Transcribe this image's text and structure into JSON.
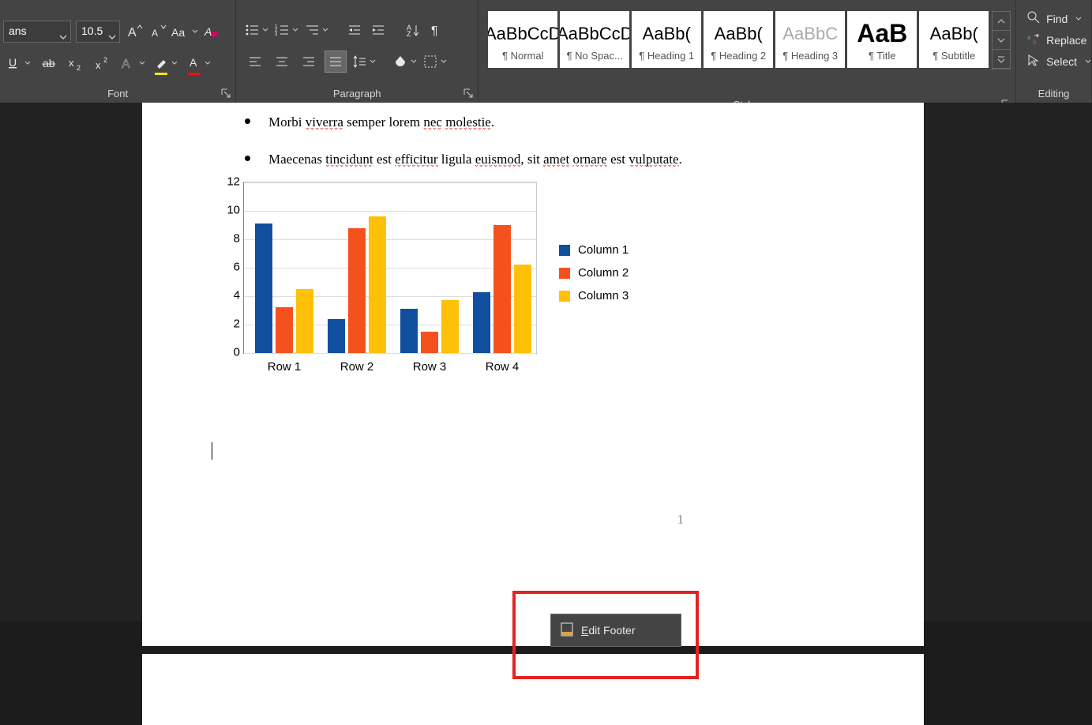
{
  "ribbon": {
    "font": {
      "group_label": "Font",
      "font_name": "ans",
      "font_size": "10.5"
    },
    "paragraph": {
      "group_label": "Paragraph"
    },
    "styles": {
      "group_label": "Styles",
      "tiles": [
        {
          "sample": "AaBbCcD",
          "name": "¶ Normal"
        },
        {
          "sample": "AaBbCcD",
          "name": "¶ No Spac..."
        },
        {
          "sample": "AaBb(",
          "name": "¶ Heading 1"
        },
        {
          "sample": "AaBb(",
          "name": "¶ Heading 2"
        },
        {
          "sample": "AaBbC",
          "name": "¶ Heading 3"
        },
        {
          "sample": "AaB",
          "name": "¶ Title"
        },
        {
          "sample": "AaBb(",
          "name": "¶ Subtitle"
        }
      ]
    },
    "editing": {
      "group_label": "Editing",
      "find": "Find",
      "replace": "Replace",
      "select": "Select"
    }
  },
  "document": {
    "bullets": [
      {
        "pre": "Morbi ",
        "sq1": "viverra",
        "mid": " semper lorem ",
        "sq2": "nec",
        "mid2": " ",
        "sq3": "molestie",
        "post": "."
      },
      {
        "pre": "Maecenas ",
        "sq1": "tincidunt",
        "mid": " est ",
        "sq2": "efficitur",
        "mid2": " ligula ",
        "sq3": "euismod",
        "post2": ", sit ",
        "sq4": "amet",
        "post3": " ",
        "sq5": "ornare",
        "post4": " est ",
        "sq6": "vulputate",
        "post5": "."
      }
    ],
    "page_number": "1"
  },
  "context_menu": {
    "edit_footer": "Edit Footer"
  },
  "chart_data": {
    "type": "bar",
    "categories": [
      "Row 1",
      "Row 2",
      "Row 3",
      "Row 4"
    ],
    "series": [
      {
        "name": "Column 1",
        "color": "#104f9e",
        "values": [
          9.1,
          2.4,
          3.1,
          4.3
        ]
      },
      {
        "name": "Column 2",
        "color": "#f4511e",
        "values": [
          3.2,
          8.8,
          1.5,
          9.0
        ]
      },
      {
        "name": "Column 3",
        "color": "#ffc107",
        "values": [
          4.5,
          9.6,
          3.7,
          6.2
        ]
      }
    ],
    "ylim": [
      0,
      12
    ],
    "yticks": [
      0,
      2,
      4,
      6,
      8,
      10,
      12
    ]
  }
}
